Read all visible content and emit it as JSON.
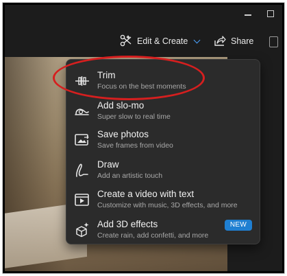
{
  "toolbar": {
    "edit_create_label": "Edit & Create",
    "share_label": "Share"
  },
  "menu": {
    "items": [
      {
        "title": "Trim",
        "subtitle": "Focus on the best moments",
        "icon": "trim-icon"
      },
      {
        "title": "Add slo-mo",
        "subtitle": "Super slow to real time",
        "icon": "slomo-icon"
      },
      {
        "title": "Save photos",
        "subtitle": "Save frames from video",
        "icon": "save-photos-icon"
      },
      {
        "title": "Draw",
        "subtitle": "Add an artistic touch",
        "icon": "draw-icon"
      },
      {
        "title": "Create a video with text",
        "subtitle": "Customize with music, 3D effects, and more",
        "icon": "video-text-icon"
      },
      {
        "title": "Add 3D effects",
        "subtitle": "Create rain, add confetti, and more",
        "icon": "3d-effects-icon",
        "badge": "NEW"
      }
    ]
  },
  "colors": {
    "accent": "#1f7fd1",
    "highlight": "#d61f1f",
    "menu_bg": "#2b2b2b"
  }
}
